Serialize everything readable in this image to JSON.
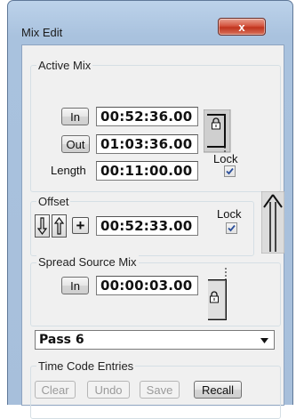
{
  "window": {
    "title": "Mix Edit",
    "close_label": "x"
  },
  "active_mix": {
    "group_label": "Active Mix",
    "in_button": "In",
    "in_value": "00:52:36.00",
    "out_button": "Out",
    "out_value": "01:03:36.00",
    "length_label": "Length",
    "length_value": "00:11:00.00",
    "lock_label": "Lock",
    "lock_checked": true
  },
  "offset": {
    "group_label": "Offset",
    "plus_label": "+",
    "value": "00:52:33.00",
    "lock_label": "Lock",
    "lock_checked": true
  },
  "spread_source_mix": {
    "group_label": "Spread Source Mix",
    "in_button": "In",
    "value": "00:00:03.00"
  },
  "pass_select": {
    "selected": "Pass 6"
  },
  "time_code_entries": {
    "group_label": "Time Code Entries",
    "buttons": {
      "clear": "Clear",
      "undo": "Undo",
      "save": "Save",
      "recall": "Recall"
    }
  },
  "icons": [
    "close-icon",
    "padlock-icon",
    "down-arrow-icon",
    "up-arrow-icon",
    "dropdown-arrow-icon",
    "checkmark-icon"
  ]
}
